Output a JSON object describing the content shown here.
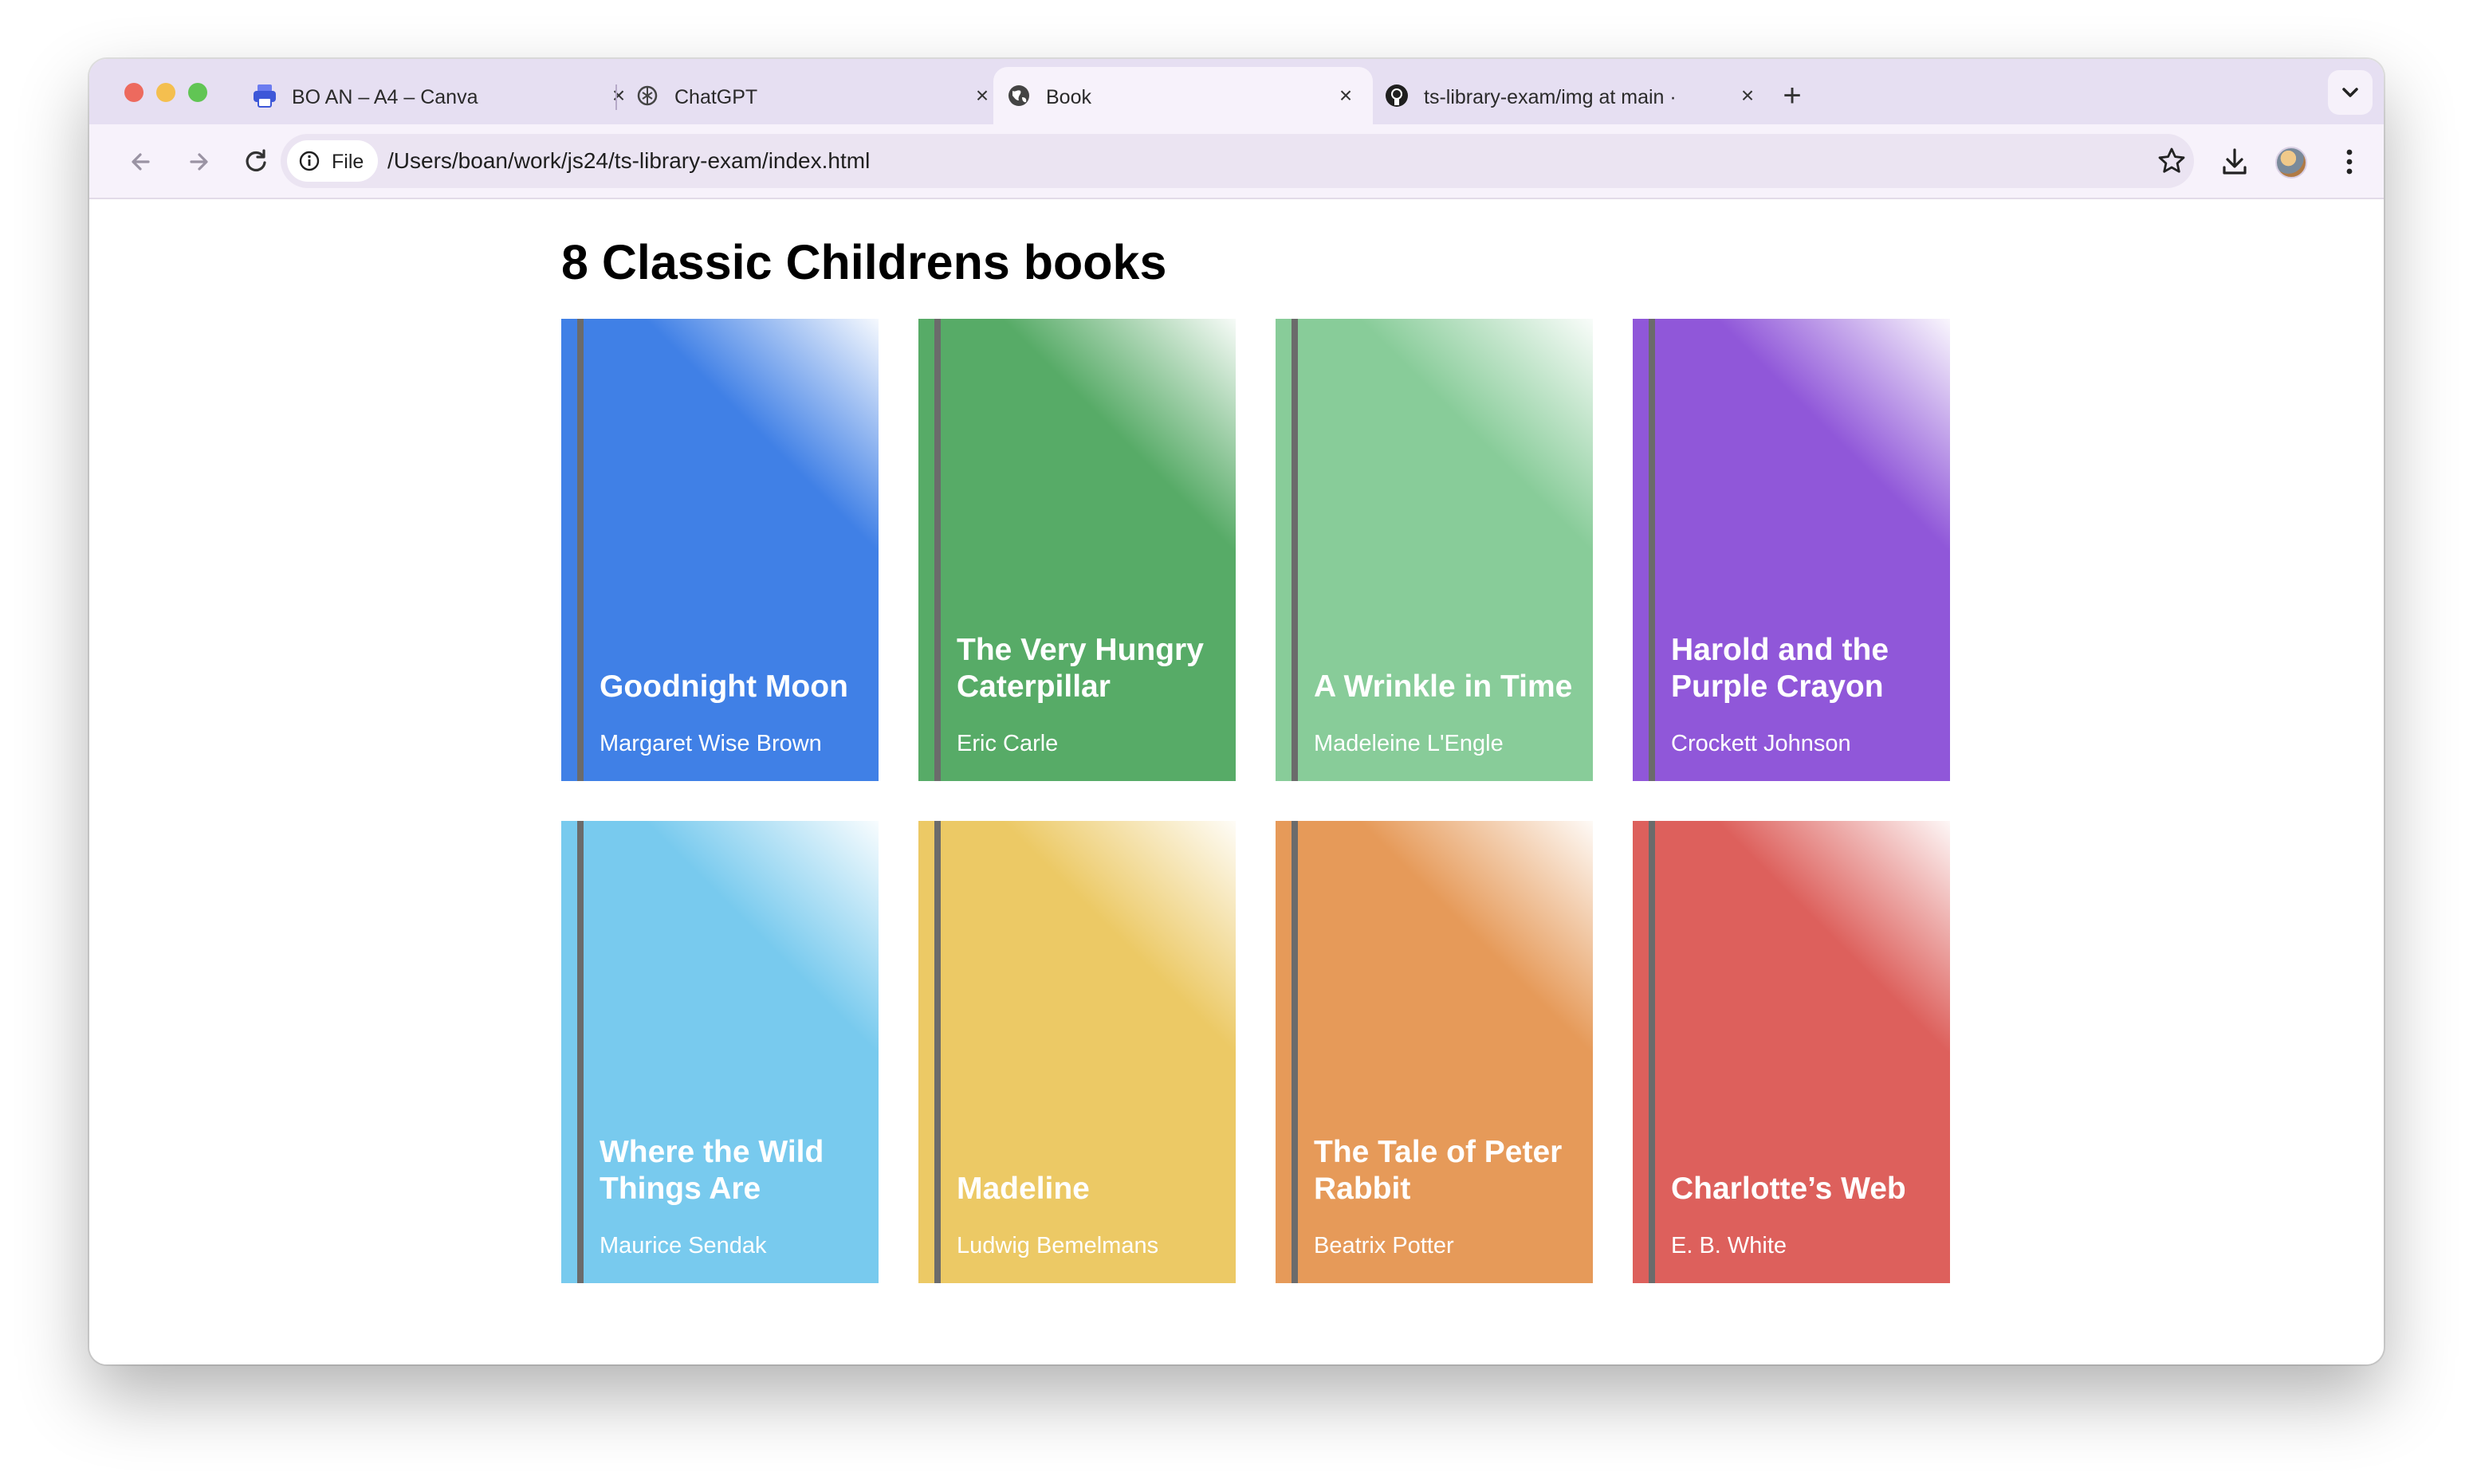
{
  "browser": {
    "tabs": [
      {
        "title": "BO AN – A4 – Canva",
        "icon": "canva-printer-icon",
        "active": false
      },
      {
        "title": "ChatGPT",
        "icon": "chatgpt-icon",
        "active": false
      },
      {
        "title": "Book",
        "icon": "globe-icon",
        "active": true
      },
      {
        "title": "ts-library-exam/img at main ·",
        "icon": "github-icon",
        "active": false
      }
    ],
    "new_tab_label": "+",
    "close_glyph": "×",
    "site_chip": "File",
    "url": "/Users/boan/work/js24/ts-library-exam/index.html"
  },
  "page": {
    "title": "8 Classic Childrens books",
    "books": [
      {
        "title": "Goodnight Moon",
        "author": "Margaret Wise Brown",
        "color": "#4080e6"
      },
      {
        "title": "The Very Hungry Caterpillar",
        "author": "Eric Carle",
        "color": "#57ab67"
      },
      {
        "title": "A Wrinkle in Time",
        "author": "Madeleine L'Engle",
        "color": "#88cc99"
      },
      {
        "title": "Harold and the Purple Crayon",
        "author": "Crockett Johnson",
        "color": "#9057d9"
      },
      {
        "title": "Where the Wild Things Are",
        "author": "Maurice Sendak",
        "color": "#78caee"
      },
      {
        "title": "Madeline",
        "author": "Ludwig Bemelmans",
        "color": "#ecc965"
      },
      {
        "title": "The Tale of Peter Rabbit",
        "author": "Beatrix Potter",
        "color": "#e69a59"
      },
      {
        "title": "Charlotte’s Web",
        "author": "E. B. White",
        "color": "#dd605c"
      }
    ]
  },
  "colors": {
    "tabbar_bg": "#e6dff2",
    "toolbar_bg": "#f7f2fb",
    "spine": "#6b6b6b"
  }
}
